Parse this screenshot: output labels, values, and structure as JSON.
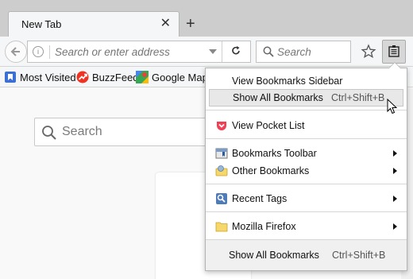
{
  "tabs": [
    {
      "title": "New Tab"
    }
  ],
  "navbar": {
    "url_placeholder": "Search or enter address",
    "search_placeholder": "Search"
  },
  "bookmarks_toolbar": [
    {
      "label": "Most Visited",
      "icon": "most-visited-icon"
    },
    {
      "label": "BuzzFeed",
      "icon": "buzzfeed-icon"
    },
    {
      "label": "Google Maps",
      "icon": "google-maps-icon"
    }
  ],
  "page": {
    "search_placeholder": "Search"
  },
  "library_panel": {
    "items": [
      {
        "label": "View Bookmarks Sidebar",
        "shortcut": ""
      },
      {
        "label": "Show All Bookmarks",
        "shortcut": "Ctrl+Shift+B",
        "highlighted": true
      },
      {
        "label": "View Pocket List",
        "icon": "pocket-icon"
      },
      {
        "label": "Bookmarks Toolbar",
        "icon": "bookmarks-toolbar-icon",
        "submenu": true
      },
      {
        "label": "Other Bookmarks",
        "icon": "other-bookmarks-icon",
        "submenu": true
      },
      {
        "label": "Recent Tags",
        "icon": "recent-tags-icon",
        "submenu": true
      },
      {
        "label": "Mozilla Firefox",
        "icon": "folder-icon",
        "submenu": true
      }
    ],
    "footer": {
      "label": "Show All Bookmarks",
      "shortcut": "Ctrl+Shift+B"
    }
  },
  "colors": {
    "pocket": "#ef4056",
    "buzzfeed": "#ee3322",
    "folder": "#f6d76b"
  }
}
